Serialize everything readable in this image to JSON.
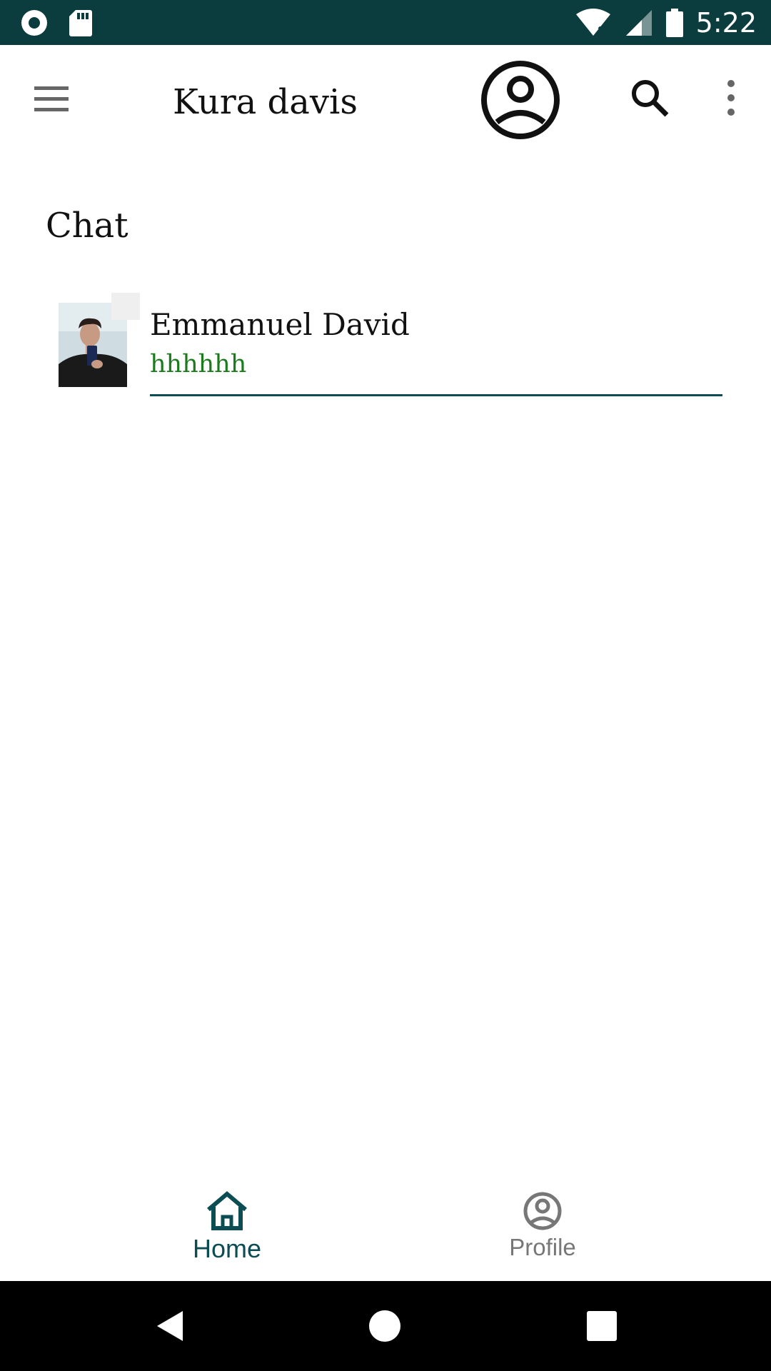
{
  "status_bar": {
    "time": "5:22",
    "icons": [
      "record-icon",
      "sd-card-icon",
      "wifi-off-icon",
      "signal-icon",
      "battery-icon"
    ]
  },
  "app_bar": {
    "title": "Kura davis",
    "icons": [
      "menu-icon",
      "account-circle-icon",
      "search-icon",
      "more-vert-icon"
    ]
  },
  "section": {
    "title": "Chat"
  },
  "chats": [
    {
      "name": "Emmanuel David",
      "last_message": "hhhhhh"
    }
  ],
  "bottom_nav": {
    "items": [
      {
        "label": "Home",
        "icon": "home-icon",
        "selected": true
      },
      {
        "label": "Profile",
        "icon": "account-circle-icon",
        "selected": false
      }
    ]
  },
  "colors": {
    "primary_dark": "#0b3c3e",
    "primary": "#0b4d52",
    "message_green": "#1b7a1b",
    "inactive": "#777777"
  }
}
